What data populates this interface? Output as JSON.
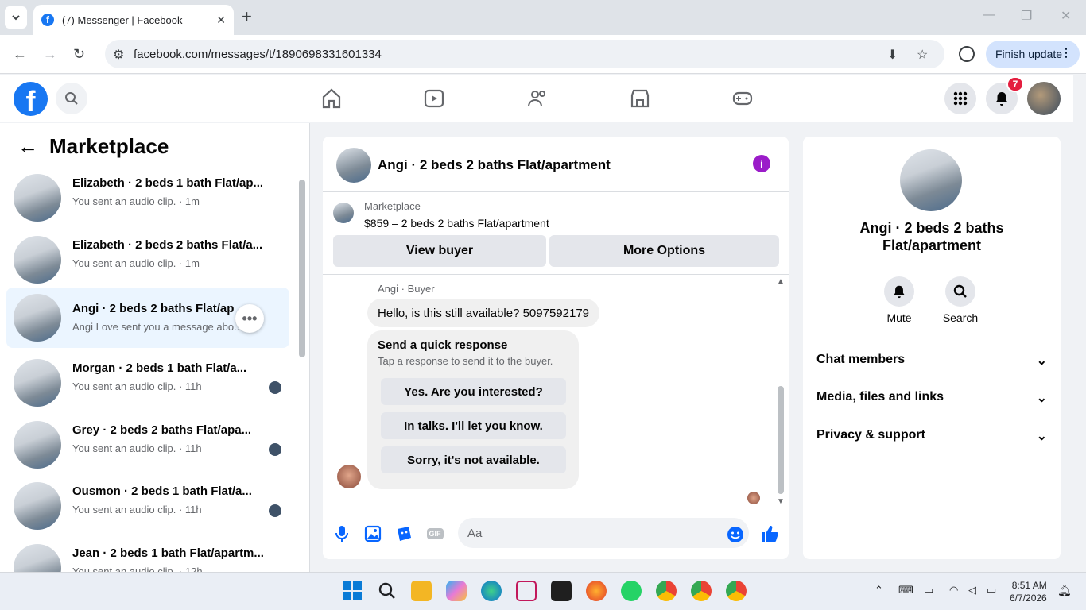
{
  "browser": {
    "tab_title": "(7) Messenger | Facebook",
    "url": "facebook.com/messages/t/1890698331601334",
    "finish_update": "Finish update"
  },
  "fb": {
    "notif_count": "7"
  },
  "marketplace": {
    "title": "Marketplace",
    "convos": [
      {
        "name": "Elizabeth · 2 beds 1 bath Flat/ap...",
        "sub": "You sent an audio clip. · 1m"
      },
      {
        "name": "Elizabeth · 2 beds 2 baths Flat/a...",
        "sub": "You sent an audio clip. · 1m"
      },
      {
        "name": "Angi · 2 beds 2 baths Flat/ap",
        "sub": "Angi Love sent you a message abo... 4h"
      },
      {
        "name": "Morgan · 2 beds 1 bath Flat/a...",
        "sub": "You sent an audio clip. · 11h"
      },
      {
        "name": "Grey · 2 beds 2 baths Flat/apa...",
        "sub": "You sent an audio clip. · 11h"
      },
      {
        "name": "Ousmon · 2 beds 1 bath Flat/a...",
        "sub": "You sent an audio clip. · 11h"
      },
      {
        "name": "Jean · 2 beds 1 bath Flat/apartm...",
        "sub": "You sent an audio clip. · 12h"
      }
    ]
  },
  "chat": {
    "title": "Angi · 2 beds 2 baths Flat/apartment",
    "mkt_label": "Marketplace",
    "listing": "$859 – 2 beds 2 baths Flat/apartment",
    "view_buyer": "View buyer",
    "more_options": "More Options",
    "sender": "Angi · Buyer",
    "message": "Hello, is this still available? 5097592179",
    "qr_title": "Send a quick response",
    "qr_sub": "Tap a response to send it to the buyer.",
    "qr_options": [
      "Yes. Are you interested?",
      "In talks. I'll let you know.",
      "Sorry, it's not available."
    ],
    "placeholder": "Aa",
    "gif": "GIF"
  },
  "right": {
    "name": "Angi · 2 beds 2 baths Flat/apartment",
    "mute": "Mute",
    "search": "Search",
    "sections": [
      "Chat members",
      "Media, files and links",
      "Privacy & support"
    ]
  },
  "taskbar": {
    "time": "8:51 AM",
    "date": "6/7/2026"
  }
}
